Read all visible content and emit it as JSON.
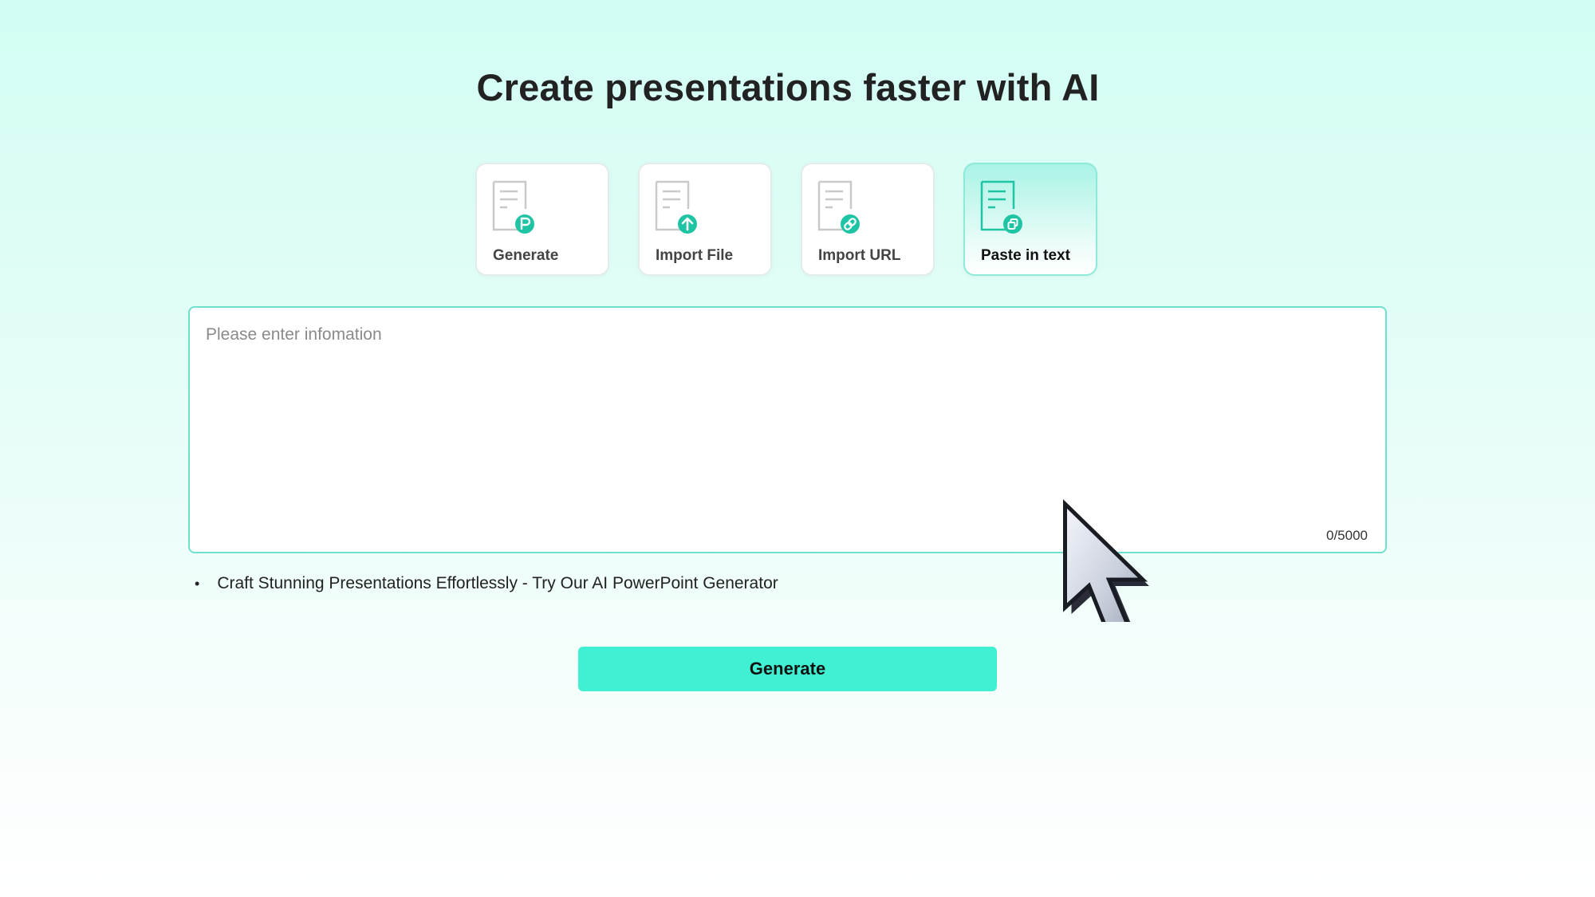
{
  "page": {
    "title": "Create presentations faster with AI"
  },
  "modes": [
    {
      "label": "Generate",
      "icon": "doc-p-icon",
      "active": false
    },
    {
      "label": "Import File",
      "icon": "doc-upload-icon",
      "active": false
    },
    {
      "label": "Import URL",
      "icon": "doc-link-icon",
      "active": false
    },
    {
      "label": "Paste in text",
      "icon": "doc-paste-icon",
      "active": true
    }
  ],
  "input": {
    "placeholder": "Please enter infomation",
    "value": "",
    "counter": "0/5000"
  },
  "tip": {
    "text": "Craft Stunning Presentations Effortlessly - Try Our AI PowerPoint Generator"
  },
  "actions": {
    "generate_label": "Generate"
  },
  "colors": {
    "accent": "#40f0d3",
    "icon_teal": "#1fc4a4",
    "border_active": "#6ee0cc"
  }
}
